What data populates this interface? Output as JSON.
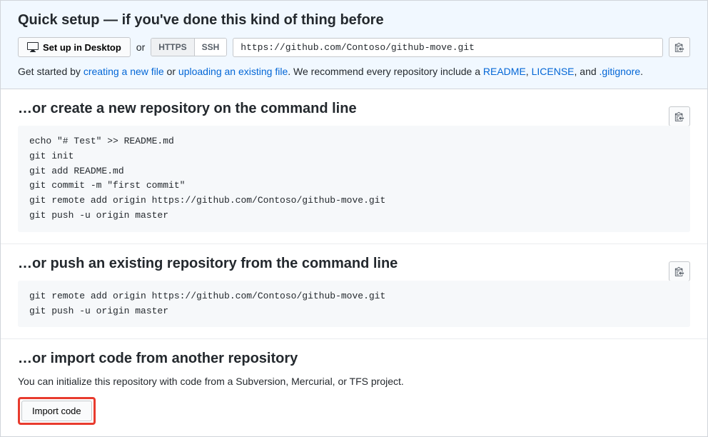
{
  "quickSetup": {
    "title": "Quick setup — if you've done this kind of thing before",
    "desktopBtn": "Set up in Desktop",
    "orText": "or",
    "protoHttps": "HTTPS",
    "protoSsh": "SSH",
    "url": "https://github.com/Contoso/github-move.git",
    "helpPrefix": "Get started by ",
    "linkNewFile": "creating a new file",
    "helpOr": " or ",
    "linkUpload": "uploading an existing file",
    "helpMid": ". We recommend every repository include a ",
    "linkReadme": "README",
    "helpComma": ", ",
    "linkLicense": "LICENSE",
    "helpAnd": ", and ",
    "linkGitignore": ".gitignore",
    "helpEnd": "."
  },
  "createSection": {
    "title": "…or create a new repository on the command line",
    "code": "echo \"# Test\" >> README.md\ngit init\ngit add README.md\ngit commit -m \"first commit\"\ngit remote add origin https://github.com/Contoso/github-move.git\ngit push -u origin master"
  },
  "pushSection": {
    "title": "…or push an existing repository from the command line",
    "code": "git remote add origin https://github.com/Contoso/github-move.git\ngit push -u origin master"
  },
  "importSection": {
    "title": "…or import code from another repository",
    "desc": "You can initialize this repository with code from a Subversion, Mercurial, or TFS project.",
    "btnLabel": "Import code"
  }
}
